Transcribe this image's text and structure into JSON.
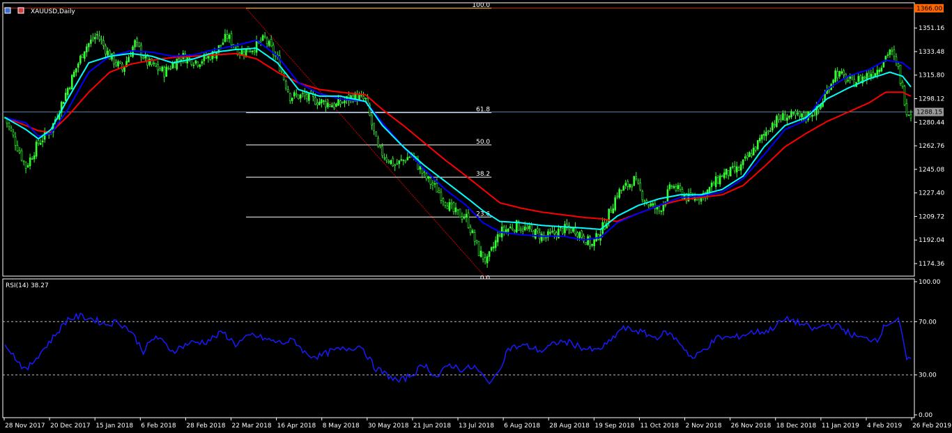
{
  "window_title": "XAUUSD,Daily",
  "indicator_label": "RSI(14) 38.27",
  "colors": {
    "background": "#000000",
    "bull_candle": "#33ff33",
    "ma_fast": "#00ffff",
    "ma_mid": "#0000ff",
    "ma_slow": "#ff0000",
    "rsi_line": "#1a1aff",
    "fib_line": "#ffffff",
    "fib_diagonal": "#cc0000",
    "price_tag_bg": "#ff6600",
    "current_price_bg": "#999999"
  },
  "chart_data": [
    {
      "type": "candlestick",
      "symbol": "XAUUSD",
      "timeframe": "Daily",
      "ylim": [
        1166.0,
        1369.04
      ],
      "y_ticks": [
        "1351.16",
        "1333.48",
        "1315.80",
        "1298.12",
        "1280.44",
        "1262.76",
        "1245.08",
        "1227.40",
        "1209.72",
        "1192.04",
        "1174.36"
      ],
      "x_tick_labels": [
        "28 Nov 2017",
        "20 Dec 2017",
        "15 Jan 2018",
        "6 Feb 2018",
        "28 Feb 2018",
        "22 Mar 2018",
        "16 Apr 2018",
        "8 May 2018",
        "30 May 2018",
        "21 Jun 2018",
        "13 Jul 2018",
        "6 Aug 2018",
        "28 Aug 2018",
        "19 Sep 2018",
        "11 Oct 2018",
        "2 Nov 2018",
        "26 Nov 2018",
        "18 Dec 2018",
        "11 Jan 2019",
        "4 Feb 2019",
        "26 Feb 2019"
      ],
      "price_levels": {
        "high_line": "1366.00",
        "current_price": "1288.15"
      },
      "fibonacci": {
        "levels": [
          {
            "label": "100.0",
            "price": 1366.0
          },
          {
            "label": "61.8",
            "price": 1287.6
          },
          {
            "label": "50.0",
            "price": 1263.4
          },
          {
            "label": "38.2",
            "price": 1239.2
          },
          {
            "label": "23.6",
            "price": 1209.3
          },
          {
            "label": "0.0",
            "price": 1160.9
          }
        ]
      },
      "close_keypoints": [
        [
          0,
          1284
        ],
        [
          6,
          1262
        ],
        [
          10,
          1247
        ],
        [
          16,
          1265
        ],
        [
          22,
          1275
        ],
        [
          30,
          1306
        ],
        [
          38,
          1336
        ],
        [
          44,
          1346
        ],
        [
          50,
          1330
        ],
        [
          56,
          1320
        ],
        [
          62,
          1340
        ],
        [
          68,
          1325
        ],
        [
          76,
          1318
        ],
        [
          84,
          1330
        ],
        [
          92,
          1326
        ],
        [
          100,
          1332
        ],
        [
          106,
          1345
        ],
        [
          112,
          1333
        ],
        [
          118,
          1336
        ],
        [
          124,
          1343
        ],
        [
          130,
          1327
        ],
        [
          136,
          1300
        ],
        [
          142,
          1300
        ],
        [
          150,
          1296
        ],
        [
          158,
          1293
        ],
        [
          166,
          1300
        ],
        [
          172,
          1297
        ],
        [
          178,
          1260
        ],
        [
          186,
          1248
        ],
        [
          194,
          1256
        ],
        [
          200,
          1240
        ],
        [
          206,
          1230
        ],
        [
          214,
          1213
        ],
        [
          220,
          1209
        ],
        [
          226,
          1183
        ],
        [
          230,
          1176
        ],
        [
          236,
          1198
        ],
        [
          244,
          1203
        ],
        [
          250,
          1199
        ],
        [
          258,
          1194
        ],
        [
          266,
          1200
        ],
        [
          272,
          1200
        ],
        [
          280,
          1188
        ],
        [
          286,
          1204
        ],
        [
          292,
          1227
        ],
        [
          300,
          1237
        ],
        [
          306,
          1220
        ],
        [
          312,
          1214
        ],
        [
          318,
          1233
        ],
        [
          326,
          1223
        ],
        [
          334,
          1227
        ],
        [
          342,
          1241
        ],
        [
          350,
          1245
        ],
        [
          358,
          1262
        ],
        [
          366,
          1280
        ],
        [
          372,
          1285
        ],
        [
          380,
          1284
        ],
        [
          388,
          1290
        ],
        [
          396,
          1318
        ],
        [
          404,
          1310
        ],
        [
          410,
          1315
        ],
        [
          416,
          1320
        ],
        [
          422,
          1335
        ],
        [
          426,
          1320
        ],
        [
          430,
          1290
        ],
        [
          432,
          1286
        ]
      ],
      "ma_fast_keypoints": [
        [
          0,
          1284
        ],
        [
          10,
          1275
        ],
        [
          16,
          1268
        ],
        [
          22,
          1275
        ],
        [
          30,
          1298
        ],
        [
          40,
          1325
        ],
        [
          50,
          1330
        ],
        [
          60,
          1332
        ],
        [
          70,
          1330
        ],
        [
          80,
          1325
        ],
        [
          90,
          1328
        ],
        [
          100,
          1333
        ],
        [
          110,
          1335
        ],
        [
          120,
          1336
        ],
        [
          130,
          1325
        ],
        [
          140,
          1305
        ],
        [
          150,
          1300
        ],
        [
          160,
          1300
        ],
        [
          172,
          1296
        ],
        [
          180,
          1278
        ],
        [
          190,
          1262
        ],
        [
          200,
          1248
        ],
        [
          210,
          1236
        ],
        [
          220,
          1224
        ],
        [
          228,
          1214
        ],
        [
          236,
          1206
        ],
        [
          246,
          1205
        ],
        [
          256,
          1203
        ],
        [
          266,
          1202
        ],
        [
          276,
          1201
        ],
        [
          284,
          1200
        ],
        [
          292,
          1210
        ],
        [
          302,
          1218
        ],
        [
          312,
          1223
        ],
        [
          322,
          1226
        ],
        [
          332,
          1226
        ],
        [
          342,
          1230
        ],
        [
          352,
          1240
        ],
        [
          362,
          1262
        ],
        [
          372,
          1278
        ],
        [
          382,
          1284
        ],
        [
          392,
          1298
        ],
        [
          402,
          1306
        ],
        [
          412,
          1313
        ],
        [
          422,
          1318
        ],
        [
          428,
          1315
        ],
        [
          432,
          1307
        ]
      ],
      "ma_mid_keypoints": [
        [
          0,
          1284
        ],
        [
          10,
          1280
        ],
        [
          16,
          1270
        ],
        [
          22,
          1272
        ],
        [
          30,
          1290
        ],
        [
          40,
          1318
        ],
        [
          50,
          1330
        ],
        [
          60,
          1334
        ],
        [
          70,
          1333
        ],
        [
          80,
          1330
        ],
        [
          90,
          1331
        ],
        [
          100,
          1335
        ],
        [
          110,
          1338
        ],
        [
          120,
          1342
        ],
        [
          130,
          1330
        ],
        [
          140,
          1310
        ],
        [
          150,
          1302
        ],
        [
          160,
          1298
        ],
        [
          172,
          1296
        ],
        [
          180,
          1280
        ],
        [
          190,
          1262
        ],
        [
          200,
          1245
        ],
        [
          210,
          1230
        ],
        [
          220,
          1218
        ],
        [
          228,
          1205
        ],
        [
          236,
          1198
        ],
        [
          246,
          1196
        ],
        [
          256,
          1195
        ],
        [
          266,
          1195
        ],
        [
          276,
          1192
        ],
        [
          284,
          1194
        ],
        [
          292,
          1205
        ],
        [
          302,
          1212
        ],
        [
          312,
          1218
        ],
        [
          322,
          1224
        ],
        [
          332,
          1225
        ],
        [
          342,
          1228
        ],
        [
          352,
          1238
        ],
        [
          362,
          1256
        ],
        [
          372,
          1275
        ],
        [
          382,
          1282
        ],
        [
          392,
          1305
        ],
        [
          402,
          1315
        ],
        [
          412,
          1320
        ],
        [
          420,
          1327
        ],
        [
          428,
          1325
        ],
        [
          432,
          1320
        ]
      ],
      "ma_slow_keypoints": [
        [
          0,
          1284
        ],
        [
          10,
          1278
        ],
        [
          16,
          1274
        ],
        [
          22,
          1273
        ],
        [
          30,
          1285
        ],
        [
          40,
          1303
        ],
        [
          50,
          1318
        ],
        [
          60,
          1324
        ],
        [
          70,
          1327
        ],
        [
          80,
          1329
        ],
        [
          90,
          1330
        ],
        [
          100,
          1331
        ],
        [
          110,
          1332
        ],
        [
          120,
          1328
        ],
        [
          130,
          1318
        ],
        [
          140,
          1310
        ],
        [
          150,
          1305
        ],
        [
          160,
          1303
        ],
        [
          172,
          1301
        ],
        [
          180,
          1290
        ],
        [
          190,
          1278
        ],
        [
          200,
          1265
        ],
        [
          210,
          1252
        ],
        [
          220,
          1240
        ],
        [
          228,
          1230
        ],
        [
          236,
          1220
        ],
        [
          246,
          1216
        ],
        [
          256,
          1213
        ],
        [
          266,
          1211
        ],
        [
          276,
          1209
        ],
        [
          284,
          1208
        ],
        [
          292,
          1206
        ],
        [
          302,
          1212
        ],
        [
          312,
          1218
        ],
        [
          322,
          1222
        ],
        [
          332,
          1224
        ],
        [
          342,
          1226
        ],
        [
          352,
          1233
        ],
        [
          362,
          1247
        ],
        [
          372,
          1262
        ],
        [
          382,
          1272
        ],
        [
          392,
          1281
        ],
        [
          402,
          1288
        ],
        [
          412,
          1295
        ],
        [
          420,
          1303
        ],
        [
          428,
          1303
        ],
        [
          432,
          1300
        ]
      ]
    },
    {
      "type": "line",
      "name": "RSI(14)",
      "last_value": 38.27,
      "ylim": [
        0,
        100
      ],
      "y_ticks": [
        "100.00",
        "70.00",
        "30.00",
        "0.00"
      ],
      "levels": [
        70,
        30
      ],
      "rsi_keypoints": [
        [
          0,
          55
        ],
        [
          4,
          45
        ],
        [
          10,
          33
        ],
        [
          16,
          45
        ],
        [
          22,
          56
        ],
        [
          30,
          72
        ],
        [
          36,
          74
        ],
        [
          42,
          72
        ],
        [
          48,
          68
        ],
        [
          54,
          70
        ],
        [
          60,
          63
        ],
        [
          66,
          48
        ],
        [
          72,
          59
        ],
        [
          80,
          48
        ],
        [
          88,
          54
        ],
        [
          96,
          55
        ],
        [
          104,
          62
        ],
        [
          110,
          53
        ],
        [
          118,
          60
        ],
        [
          126,
          56
        ],
        [
          132,
          54
        ],
        [
          138,
          56
        ],
        [
          144,
          45
        ],
        [
          150,
          44
        ],
        [
          156,
          48
        ],
        [
          164,
          50
        ],
        [
          170,
          52
        ],
        [
          176,
          36
        ],
        [
          182,
          30
        ],
        [
          188,
          25
        ],
        [
          194,
          30
        ],
        [
          200,
          38
        ],
        [
          206,
          28
        ],
        [
          212,
          38
        ],
        [
          218,
          34
        ],
        [
          224,
          36
        ],
        [
          230,
          25
        ],
        [
          234,
          28
        ],
        [
          240,
          50
        ],
        [
          248,
          52
        ],
        [
          256,
          48
        ],
        [
          264,
          55
        ],
        [
          270,
          54
        ],
        [
          276,
          50
        ],
        [
          282,
          48
        ],
        [
          288,
          54
        ],
        [
          294,
          65
        ],
        [
          302,
          63
        ],
        [
          310,
          58
        ],
        [
          316,
          62
        ],
        [
          322,
          54
        ],
        [
          328,
          42
        ],
        [
          334,
          50
        ],
        [
          340,
          58
        ],
        [
          348,
          58
        ],
        [
          356,
          62
        ],
        [
          364,
          63
        ],
        [
          370,
          70
        ],
        [
          374,
          72
        ],
        [
          380,
          68
        ],
        [
          386,
          64
        ],
        [
          392,
          68
        ],
        [
          398,
          66
        ],
        [
          404,
          60
        ],
        [
          410,
          57
        ],
        [
          416,
          57
        ],
        [
          420,
          68
        ],
        [
          426,
          72
        ],
        [
          430,
          42
        ],
        [
          432,
          40
        ]
      ]
    }
  ]
}
